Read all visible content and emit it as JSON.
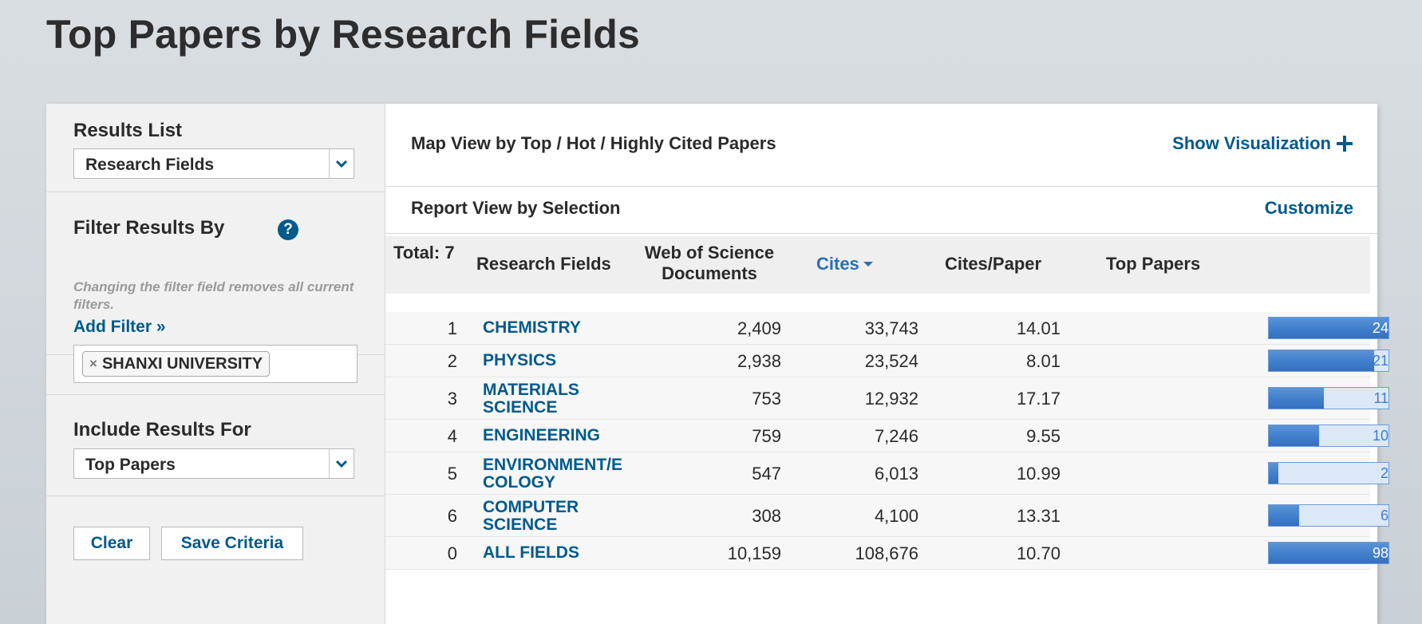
{
  "page": {
    "title": "Top Papers by Research Fields"
  },
  "sidebar": {
    "results_list_label": "Results List",
    "results_list_value": "Research Fields",
    "filter_label": "Filter Results By",
    "filter_help": "?",
    "filter_hint": "Changing the filter field removes all current filters.",
    "add_filter": "Add Filter »",
    "filter_chip": "SHANXI UNIVERSITY",
    "filter_chip_remove": "×",
    "include_label": "Include Results For",
    "include_value": "Top Papers",
    "clear_button": "Clear",
    "save_button": "Save Criteria"
  },
  "main": {
    "map_view_title": "Map View by Top / Hot / Highly Cited Papers",
    "show_visualization": "Show Visualization",
    "report_view_title": "Report View by Selection",
    "customize": "Customize"
  },
  "table": {
    "total": "Total: 7",
    "headers": {
      "field": "Research Fields",
      "wos_line1": "Web of Science",
      "wos_line2": "Documents",
      "cites": "Cites",
      "cites_per_paper": "Cites/Paper",
      "top_papers": "Top Papers"
    },
    "rows": [
      {
        "rank": "1",
        "field1": "CHEMISTRY",
        "field2": "",
        "docs": "2,409",
        "cites": "33,743",
        "cpp": "14.01",
        "top": "24",
        "fraction": 1.0
      },
      {
        "rank": "2",
        "field1": "PHYSICS",
        "field2": "",
        "docs": "2,938",
        "cites": "23,524",
        "cpp": "8.01",
        "top": "21",
        "fraction": 0.875
      },
      {
        "rank": "3",
        "field1": "MATERIALS",
        "field2": "SCIENCE",
        "docs": "753",
        "cites": "12,932",
        "cpp": "17.17",
        "top": "11",
        "fraction": 0.458
      },
      {
        "rank": "4",
        "field1": "ENGINEERING",
        "field2": "",
        "docs": "759",
        "cites": "7,246",
        "cpp": "9.55",
        "top": "10",
        "fraction": 0.417
      },
      {
        "rank": "5",
        "field1": "ENVIRONMENT/E",
        "field2": "COLOGY",
        "docs": "547",
        "cites": "6,013",
        "cpp": "10.99",
        "top": "2",
        "fraction": 0.083
      },
      {
        "rank": "6",
        "field1": "COMPUTER",
        "field2": "SCIENCE",
        "docs": "308",
        "cites": "4,100",
        "cpp": "13.31",
        "top": "6",
        "fraction": 0.25
      },
      {
        "rank": "0",
        "field1": "ALL FIELDS",
        "field2": "",
        "docs": "10,159",
        "cites": "108,676",
        "cpp": "10.70",
        "top": "98",
        "fraction": 1.0
      }
    ]
  },
  "colors": {
    "link": "#005a8b",
    "bar": "#3f7dca",
    "bar_bg": "#dde8f7"
  }
}
